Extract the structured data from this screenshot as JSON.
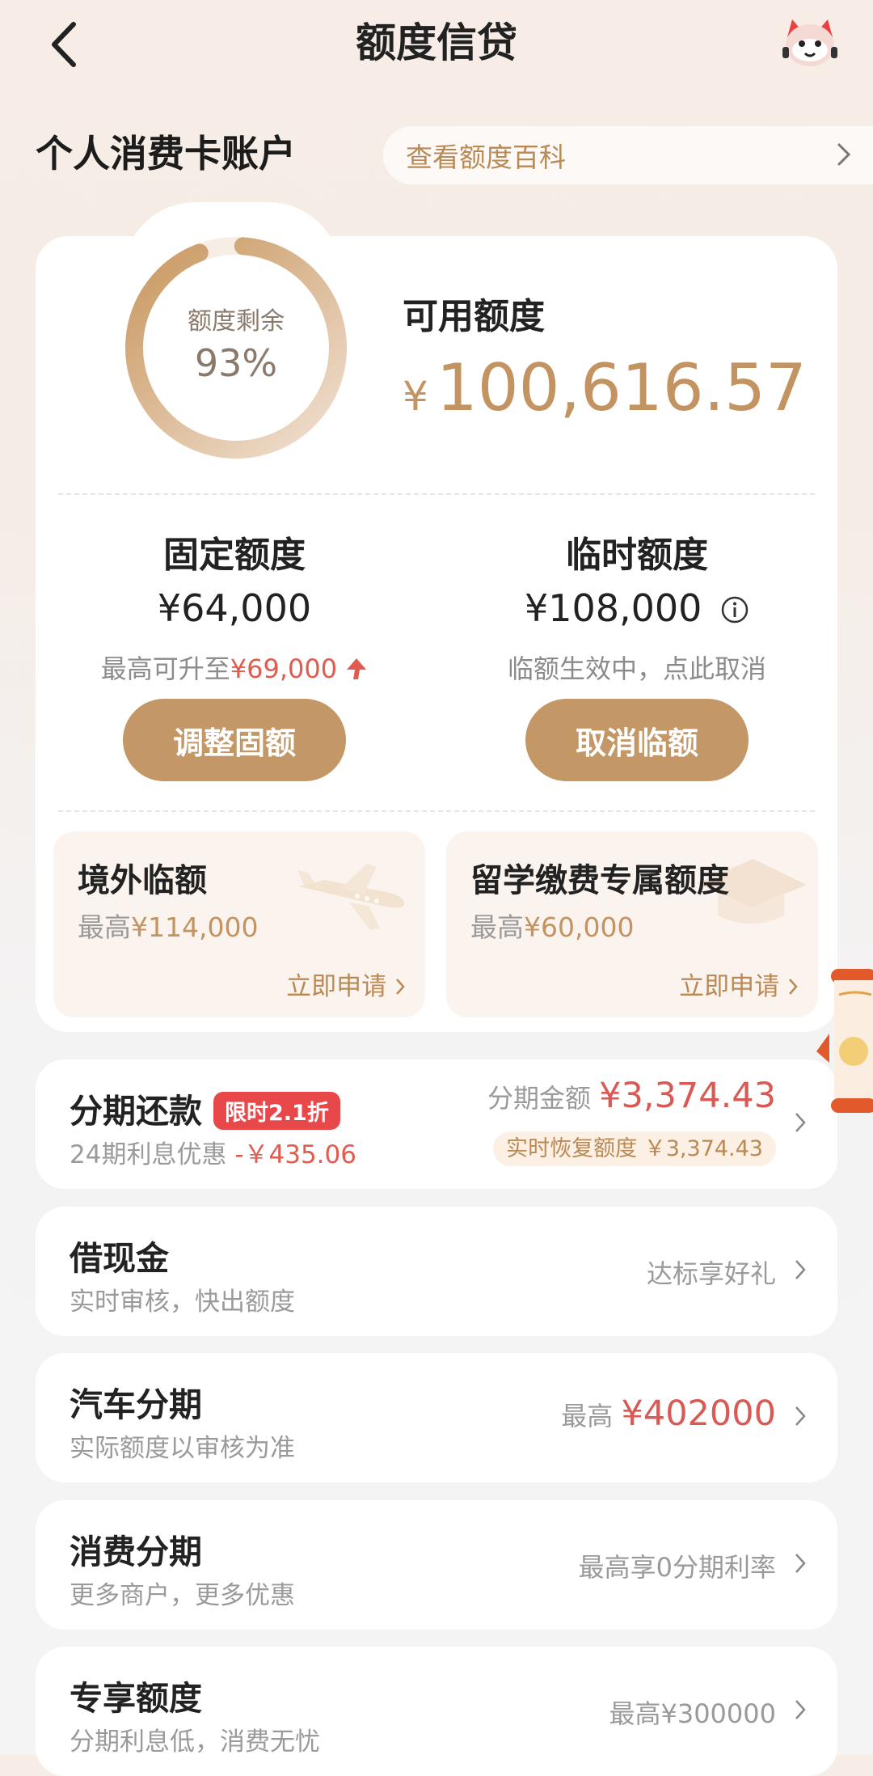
{
  "header": {
    "title": "额度信贷"
  },
  "account": {
    "title": "个人消费卡账户",
    "wiki_link": "查看额度百科"
  },
  "summary": {
    "ring_label": "额度剩余",
    "ring_percent": "93%",
    "ring_fraction": 0.93,
    "available_label": "可用额度",
    "available_currency": "¥",
    "available_amount": "100,616.57"
  },
  "fixed": {
    "title": "固定额度",
    "amount": "¥64,000",
    "note_prefix": "最高可升至",
    "note_value": "¥69,000",
    "button": "调整固额"
  },
  "temp": {
    "title": "临时额度",
    "amount": "¥108,000",
    "note": "临额生效中，点此取消",
    "button": "取消临额"
  },
  "overseas": {
    "title": "境外临额",
    "prefix": "最高",
    "amount": "¥114,000",
    "action": "立即申请"
  },
  "study": {
    "title": "留学缴费专属额度",
    "prefix": "最高",
    "amount": "¥60,000",
    "action": "立即申请"
  },
  "installment": {
    "title": "分期还款",
    "tag": "限时2.1折",
    "sub_prefix": "24期利息优惠",
    "sub_value": "-￥435.06",
    "amount_label": "分期金额",
    "amount": "¥3,374.43",
    "restore": "实时恢复额度 ￥3,374.43"
  },
  "cash": {
    "title": "借现金",
    "sub": "实时审核，快出额度",
    "right": "达标享好礼"
  },
  "auto": {
    "title": "汽车分期",
    "sub": "实际额度以审核为准",
    "right_prefix": "最高",
    "right_value": "¥402000"
  },
  "consumer": {
    "title": "消费分期",
    "sub": "更多商户，更多优惠",
    "right": "最高享0分期利率"
  },
  "exclusive": {
    "title": "专享额度",
    "sub": "分期利息低，消费无忧",
    "right": "最高¥300000"
  },
  "colors": {
    "gold": "#c39766",
    "gold_text": "#c39361",
    "red": "#e15b4f",
    "tag_red": "#e8484a"
  }
}
